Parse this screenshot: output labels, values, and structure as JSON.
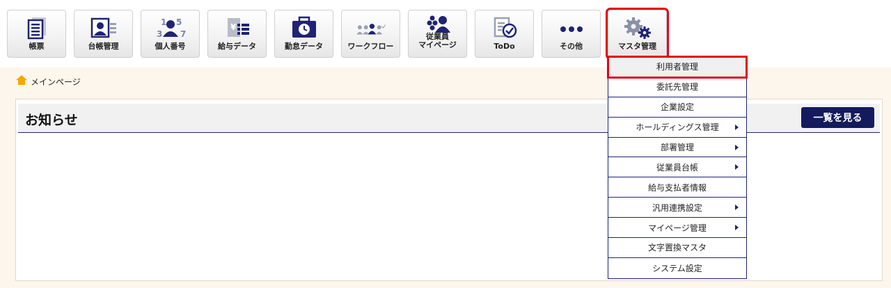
{
  "toolbar": {
    "buttons": [
      {
        "label": "帳票",
        "icon": "document-list-icon"
      },
      {
        "label": "台帳管理",
        "icon": "id-card-icon"
      },
      {
        "label": "個人番号",
        "icon": "my-number-icon"
      },
      {
        "label": "給与データ",
        "icon": "yen-document-icon"
      },
      {
        "label": "勤怠データ",
        "icon": "clock-briefcase-icon"
      },
      {
        "label": "ワークフロー",
        "icon": "workflow-people-icon"
      },
      {
        "label_line1": "従業員",
        "label_line2": "マイページ",
        "icon": "employee-group-icon"
      },
      {
        "label": "ToDo",
        "icon": "todo-check-icon"
      },
      {
        "label": "その他",
        "icon": "more-dots-icon"
      },
      {
        "label": "マスタ管理",
        "icon": "gears-icon",
        "selected": true
      }
    ]
  },
  "breadcrumb": {
    "home_icon": "home-icon",
    "text": "メインページ"
  },
  "notice_panel": {
    "title": "お知らせ",
    "view_all_label": "一覧を見る"
  },
  "master_menu": {
    "items": [
      {
        "label": "利用者管理",
        "has_submenu": false,
        "active": true
      },
      {
        "label": "委託先管理",
        "has_submenu": false
      },
      {
        "label": "企業設定",
        "has_submenu": false
      },
      {
        "label": "ホールディングス管理",
        "has_submenu": true
      },
      {
        "label": "部署管理",
        "has_submenu": true
      },
      {
        "label": "従業員台帳",
        "has_submenu": true
      },
      {
        "label": "給与支払者情報",
        "has_submenu": false
      },
      {
        "label": "汎用連携設定",
        "has_submenu": true
      },
      {
        "label": "マイページ管理",
        "has_submenu": true
      },
      {
        "label": "文字置換マスタ",
        "has_submenu": false
      },
      {
        "label": "システム設定",
        "has_submenu": false
      }
    ]
  },
  "colors": {
    "navy": "#1f2373",
    "highlight_red": "#e3001b",
    "page_bg": "#fdf6ec",
    "icon_navy": "#1f2373"
  }
}
